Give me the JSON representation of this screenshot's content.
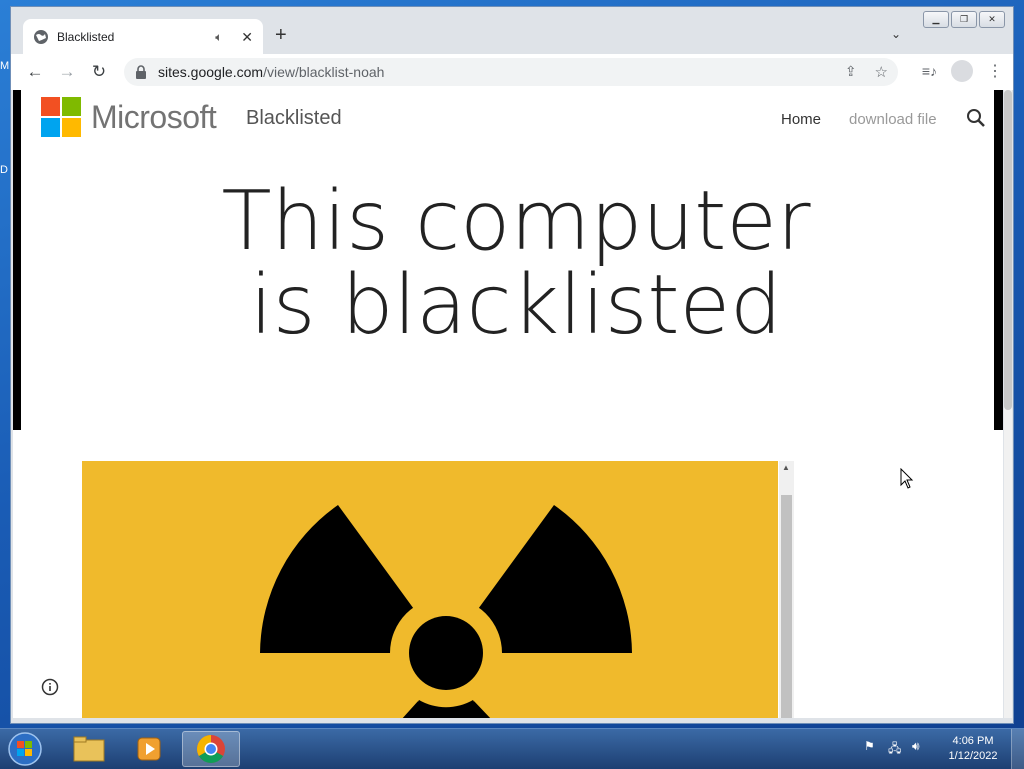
{
  "desktop": {
    "edge_labels": [
      "M",
      "D"
    ]
  },
  "browser": {
    "tab": {
      "title": "Blacklisted"
    },
    "omnibox": {
      "host": "sites.google.com",
      "path": "/view/blacklist-noah"
    }
  },
  "site": {
    "brand": "Microsoft",
    "site_name": "Blacklisted",
    "nav": {
      "home": "Home",
      "download": "download file"
    },
    "headline_line1": "This computer",
    "headline_line2": "is blacklisted",
    "image_bg_color": "#f0ba2c"
  },
  "taskbar": {
    "clock_time": "4:06 PM",
    "clock_date": "1/12/2022"
  },
  "colors": {
    "ms_red": "#f25022",
    "ms_green": "#7fba00",
    "ms_blue": "#00a4ef",
    "ms_yellow": "#ffb900"
  }
}
